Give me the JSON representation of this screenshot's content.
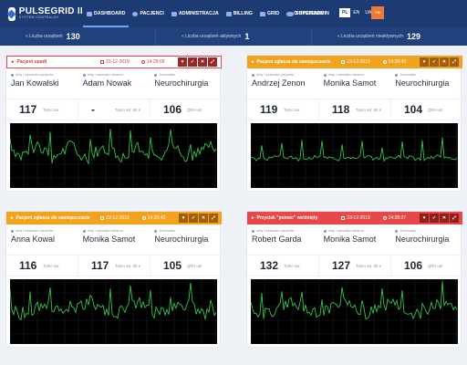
{
  "app": {
    "title": "PULSEGRID II",
    "subtitle": "SYSTEM CENTRALNY"
  },
  "nav": [
    {
      "label": "DASHBOARD",
      "icon": "dashboard-icon"
    },
    {
      "label": "PACJENCI",
      "icon": "patients-icon"
    },
    {
      "label": "ADMINISTRACJA",
      "icon": "admin-icon"
    },
    {
      "label": "BILLING",
      "icon": "billing-icon"
    },
    {
      "label": "GRID",
      "icon": "grid-icon"
    },
    {
      "label": "O SYSTEMIE",
      "icon": "info-icon"
    }
  ],
  "user": {
    "label": "SUPER ADMIN"
  },
  "languages": [
    "PL",
    "EN",
    "UA"
  ],
  "logout_icon": "logout-icon",
  "stats": [
    {
      "label": "« Liczba urządzeń",
      "value": "130"
    },
    {
      "label": "« Liczba urządzeń aktywnych",
      "value": "1"
    },
    {
      "label": "« Liczba urządzeń nieaktywnych",
      "value": "129"
    }
  ],
  "field_labels": {
    "patient": "Imię i nazwisko pacjenta",
    "doctor": "Imię i nazwisko lekarza",
    "unit": "Jednostka"
  },
  "vital_labels": {
    "heart_rate": "Tętno usr.",
    "heart_rate_60": "Tętno usr. 60 s",
    "qrs": "QRS usr."
  },
  "colors": {
    "orange": "#f2a31b",
    "red": "#e94848",
    "navy": "#1d3b73",
    "ecg": "#33c24d"
  },
  "cards": [
    {
      "status": "Pacjent upadł",
      "style": "white",
      "date": "23-12-2019",
      "time": "14:29:09",
      "patient": "Jan Kowalski",
      "doctor": "Adam Nowak",
      "unit": "Neurochirurgia",
      "heart_rate": "117",
      "heart_rate_60": "-",
      "qrs": "106"
    },
    {
      "status": "Pacjent zgłasza złe samopoczucie",
      "style": "orange",
      "date": "23-12-2019",
      "time": "14:28:43",
      "patient": "Andrzej Zenon",
      "doctor": "Monika Samot",
      "unit": "Neurochirurgia",
      "heart_rate": "119",
      "heart_rate_60": "118",
      "qrs": "104"
    },
    {
      "status": "Pacjent zgłasza złe samopoczucie",
      "style": "orange",
      "date": "23-12-2019",
      "time": "14:28:43",
      "patient": "Anna Kowal",
      "doctor": "Monika Samot",
      "unit": "Neurochirurgia",
      "heart_rate": "116",
      "heart_rate_60": "117",
      "qrs": "105"
    },
    {
      "status": "Przycisk \"pomoc\" wciśnięty",
      "style": "red",
      "date": "23-12-2019",
      "time": "14:28:27",
      "patient": "Robert Garda",
      "doctor": "Monika Samot",
      "unit": "Neurochirurgia",
      "heart_rate": "132",
      "heart_rate_60": "127",
      "qrs": "106"
    }
  ]
}
